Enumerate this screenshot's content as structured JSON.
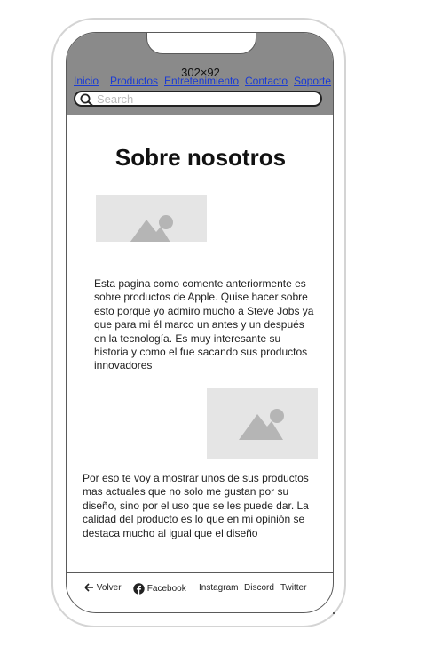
{
  "device": {
    "size_label": "302×92"
  },
  "nav": {
    "items": [
      "Inicio",
      "Productos",
      "Entretenimiento",
      "Contacto",
      "Soporte"
    ],
    "link_color": "#1a3bd4"
  },
  "search": {
    "placeholder": "Search",
    "icon": "search-icon"
  },
  "main": {
    "title": "Sobre nosotros",
    "paragraph1": "Esta pagina como comente anteriormente es sobre productos de Apple. Quise hacer sobre esto porque yo admiro mucho a Steve Jobs ya que para mi él marco un antes y un después en la tecnología. Es muy interesante su historia y como el fue sacando sus productos innovadores",
    "paragraph2": "Por eso te voy a mostrar unos de sus productos mas actuales que no solo me gustan por su diseño, sino por el uso que se les puede dar. La calidad del producto es lo que en mi opinión se destaca mucho al igual que el diseño",
    "image_icon": "image-placeholder-icon"
  },
  "footer": {
    "back": "Volver",
    "facebook": "Facebook",
    "instagram": "Instagram",
    "discord": "Discord",
    "twitter": "Twitter"
  },
  "colors": {
    "header_bg": "#8a8a8a",
    "placeholder_bg": "#e5e5e5",
    "placeholder_icon": "#b5b5b5"
  }
}
